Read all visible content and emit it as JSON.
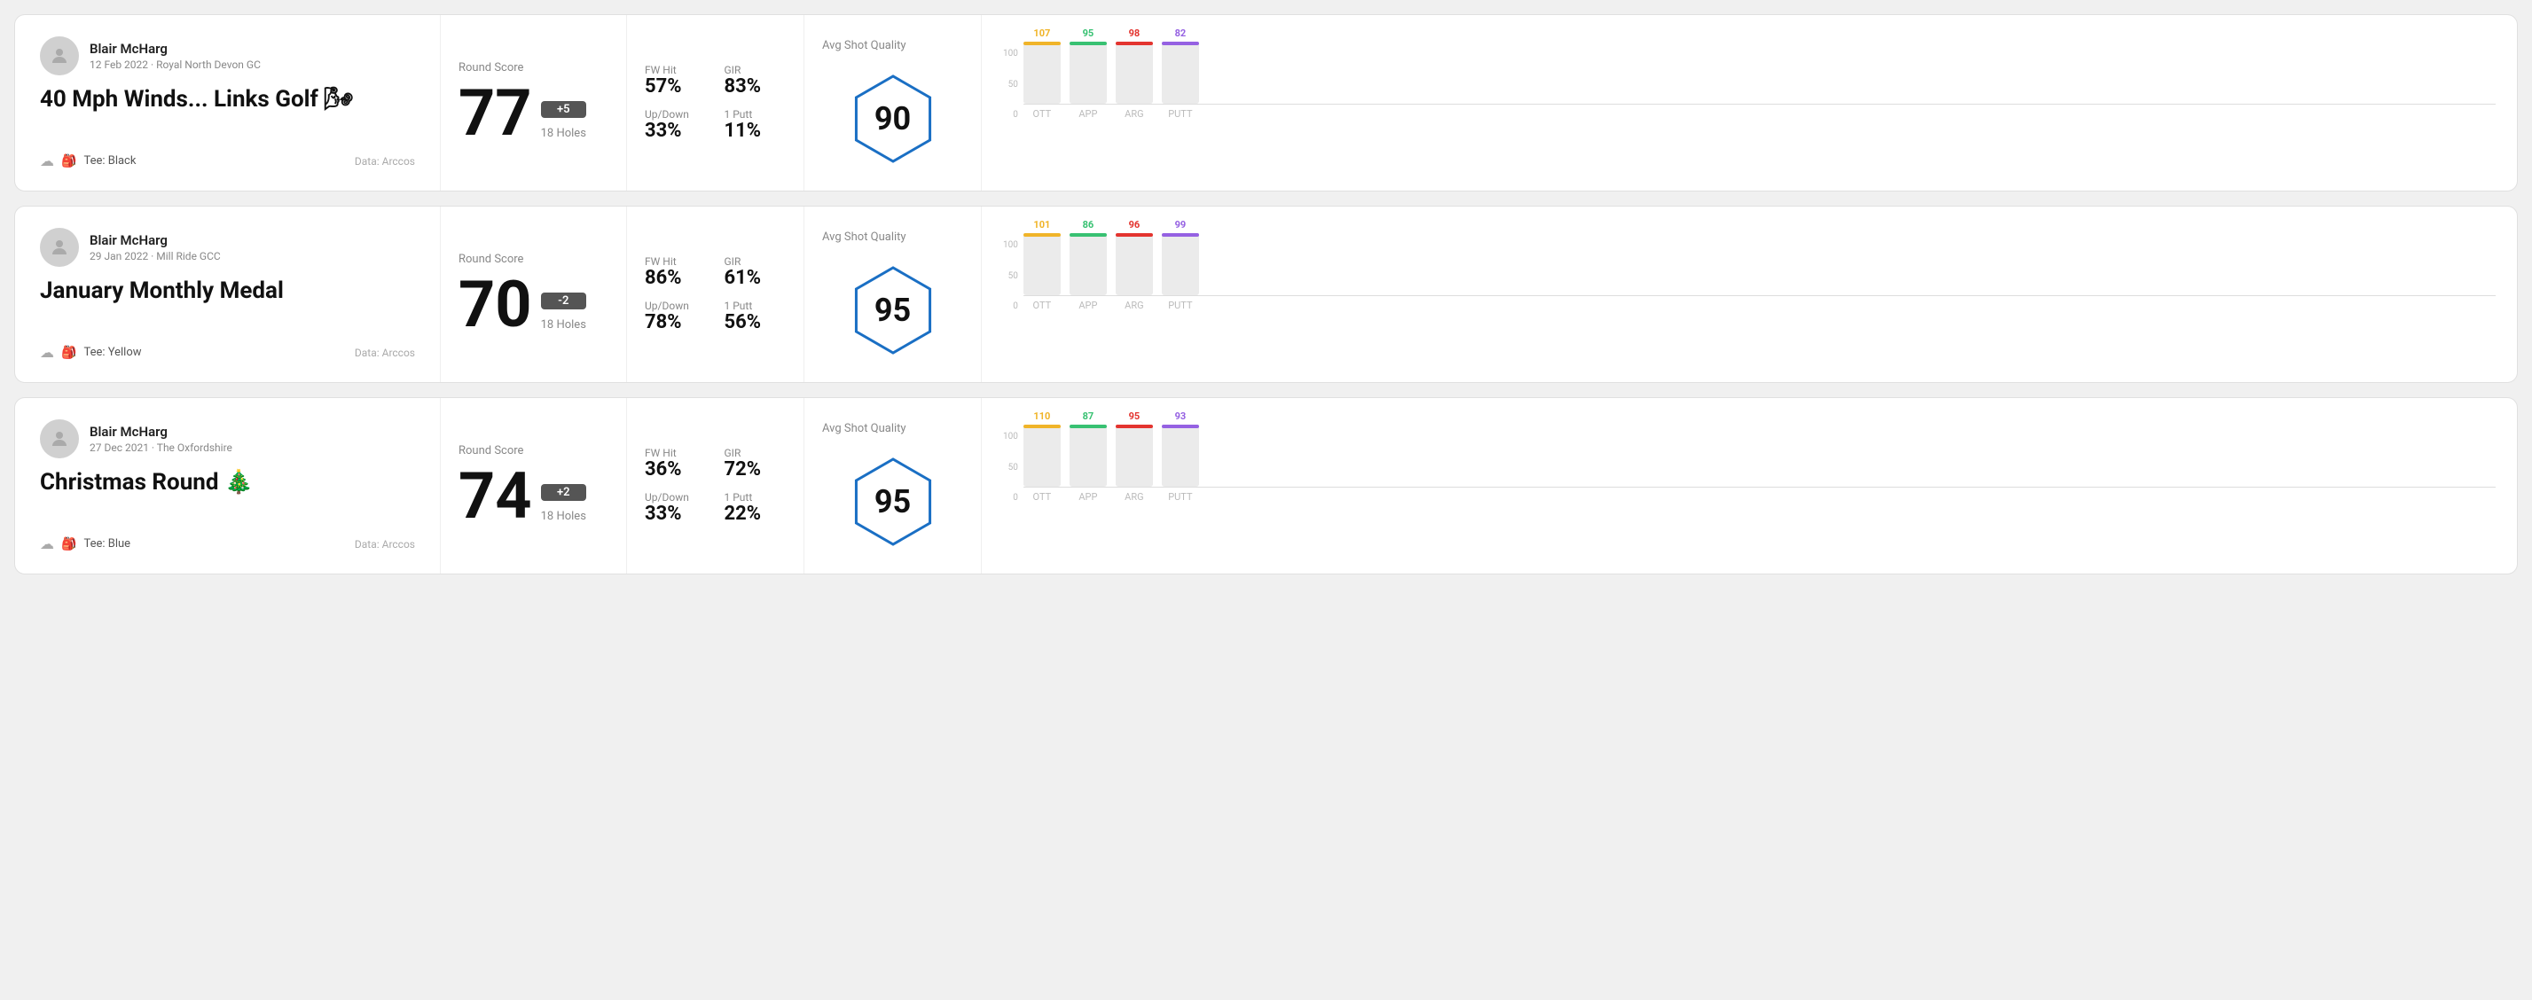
{
  "rounds": [
    {
      "id": "round1",
      "user": {
        "name": "Blair McHarg",
        "date": "12 Feb 2022",
        "course": "Royal North Devon GC"
      },
      "title": "40 Mph Winds... Links Golf 🌬",
      "tee": "Black",
      "data_source": "Data: Arccos",
      "score": {
        "value": "77",
        "modifier": "+5",
        "modifier_type": "positive",
        "holes": "18 Holes"
      },
      "stats": {
        "fw_hit_label": "FW Hit",
        "fw_hit_value": "57%",
        "gir_label": "GIR",
        "gir_value": "83%",
        "updown_label": "Up/Down",
        "updown_value": "33%",
        "one_putt_label": "1 Putt",
        "one_putt_value": "11%"
      },
      "avg_shot_quality": {
        "label": "Avg Shot Quality",
        "score": "90"
      },
      "chart": {
        "y_labels": [
          "100",
          "50",
          "0"
        ],
        "bars": [
          {
            "label": "OTT",
            "value": 107,
            "color": "#f0b429",
            "pct": 75
          },
          {
            "label": "APP",
            "value": 95,
            "color": "#38c172",
            "pct": 65
          },
          {
            "label": "ARG",
            "value": 98,
            "color": "#e3342f",
            "pct": 68
          },
          {
            "label": "PUTT",
            "value": 82,
            "color": "#9561e2",
            "pct": 55
          }
        ]
      }
    },
    {
      "id": "round2",
      "user": {
        "name": "Blair McHarg",
        "date": "29 Jan 2022",
        "course": "Mill Ride GCC"
      },
      "title": "January Monthly Medal",
      "tee": "Yellow",
      "data_source": "Data: Arccos",
      "score": {
        "value": "70",
        "modifier": "-2",
        "modifier_type": "negative",
        "holes": "18 Holes"
      },
      "stats": {
        "fw_hit_label": "FW Hit",
        "fw_hit_value": "86%",
        "gir_label": "GIR",
        "gir_value": "61%",
        "updown_label": "Up/Down",
        "updown_value": "78%",
        "one_putt_label": "1 Putt",
        "one_putt_value": "56%"
      },
      "avg_shot_quality": {
        "label": "Avg Shot Quality",
        "score": "95"
      },
      "chart": {
        "y_labels": [
          "100",
          "50",
          "0"
        ],
        "bars": [
          {
            "label": "OTT",
            "value": 101,
            "color": "#f0b429",
            "pct": 72
          },
          {
            "label": "APP",
            "value": 86,
            "color": "#38c172",
            "pct": 58
          },
          {
            "label": "ARG",
            "value": 96,
            "color": "#e3342f",
            "pct": 68
          },
          {
            "label": "PUTT",
            "value": 99,
            "color": "#9561e2",
            "pct": 70
          }
        ]
      }
    },
    {
      "id": "round3",
      "user": {
        "name": "Blair McHarg",
        "date": "27 Dec 2021",
        "course": "The Oxfordshire"
      },
      "title": "Christmas Round 🎄",
      "tee": "Blue",
      "data_source": "Data: Arccos",
      "score": {
        "value": "74",
        "modifier": "+2",
        "modifier_type": "positive",
        "holes": "18 Holes"
      },
      "stats": {
        "fw_hit_label": "FW Hit",
        "fw_hit_value": "36%",
        "gir_label": "GIR",
        "gir_value": "72%",
        "updown_label": "Up/Down",
        "updown_value": "33%",
        "one_putt_label": "1 Putt",
        "one_putt_value": "22%"
      },
      "avg_shot_quality": {
        "label": "Avg Shot Quality",
        "score": "95"
      },
      "chart": {
        "y_labels": [
          "100",
          "50",
          "0"
        ],
        "bars": [
          {
            "label": "OTT",
            "value": 110,
            "color": "#f0b429",
            "pct": 78
          },
          {
            "label": "APP",
            "value": 87,
            "color": "#38c172",
            "pct": 58
          },
          {
            "label": "ARG",
            "value": 95,
            "color": "#e3342f",
            "pct": 67
          },
          {
            "label": "PUTT",
            "value": 93,
            "color": "#9561e2",
            "pct": 66
          }
        ]
      }
    }
  ],
  "labels": {
    "round_score": "Round Score",
    "avg_shot_quality": "Avg Shot Quality",
    "data_arccos": "Data: Arccos",
    "tee_prefix": "Tee: "
  }
}
